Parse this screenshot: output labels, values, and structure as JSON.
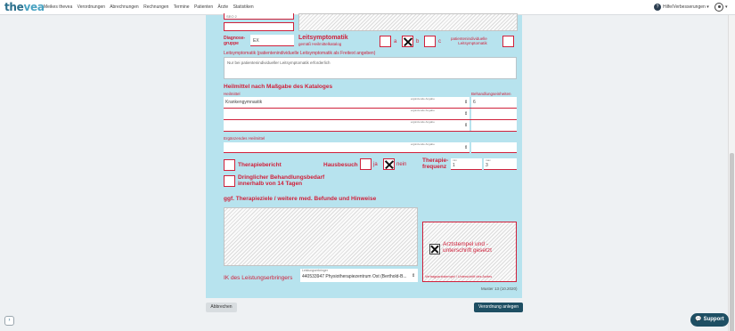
{
  "app": {
    "logo_main": "the",
    "logo_accent": "vea"
  },
  "nav": [
    "Meikes thevea",
    "Verordnungen",
    "Abrechnungen",
    "Rechnungen",
    "Termine",
    "Patienten",
    "Ärzte",
    "Statistiken"
  ],
  "header": {
    "help_label": "Hilfe/Verbesserungen",
    "help_icon_glyph": "?",
    "caret": "▾"
  },
  "form": {
    "top_field_value": "SEO 2",
    "diagnosis_group_label": "Diagnose-\ngruppe",
    "diagnosis_group_value": "EX",
    "leitsymptomatik_label": "Leitsymptomatik",
    "leitsymptomatik_sub": "gemäß Heilmittelkatalog",
    "option_a": "a",
    "option_b": "b",
    "option_c": "c",
    "option_b_checked": true,
    "patient_individual_label": "patientenindividuelle\nLeitsymptomatik",
    "freetext_label": "Leitsymptomatik (patientenindividuelle Leitsymptomatik als Freitext angeben)",
    "freetext_value": "Nur bei patientenindividueller Leitsymptomatik erforderlich",
    "heilmittel_title": "Heilmittel nach Maßgabe des Kataloges",
    "heilmittel_col": "Heilmittel",
    "units_col": "Behandlungseinheiten",
    "additional_tag": "ergänzende Angabe",
    "rows": [
      {
        "name": "Krankengymnastik",
        "units": "6"
      },
      {
        "name": "",
        "units": ""
      },
      {
        "name": "",
        "units": ""
      }
    ],
    "supplement_label": "Ergänzendes Heilmittel",
    "therapiebericht_label": "Therapiebericht",
    "hausbesuch_label": "Hausbesuch",
    "ja_label": "ja",
    "nein_label": "nein",
    "nein_checked": true,
    "frequenz_label": "Therapie-\nfrequenz",
    "freq_min_label": "min",
    "freq_max_label": "max",
    "freq_min": "1",
    "freq_max": "3",
    "urgent_label": "Dringlicher Behandlungsbedarf\ninnerhalb von 14 Tagen",
    "goals_title": "ggf. Therapieziele / weitere med. Befunde und Hinweise",
    "stamp_label": "Arztstempel und -\nunterschrift gesetzt",
    "stamp_checked": true,
    "stamp_caption": "Vertragsarztstempel / Unterschrift des Arztes",
    "ik_label": "IK des Leistungserbringers",
    "provider_label": "Leistungserbringer",
    "provider_value": "440533947 Physiotherapiezentrum Ost (Berthold-B...",
    "muster": "Muster 13 (10.2020)"
  },
  "actions": {
    "cancel": "Abbrechen",
    "create": "Verordnung anlegen"
  },
  "support": {
    "label": "Support",
    "icon_glyph": "💬"
  },
  "sidebar_toggle_glyph": "›",
  "colors": {
    "form_bg": "#b7e3ee",
    "accent_red": "#d0213b",
    "primary_dark": "#1e4f63"
  }
}
